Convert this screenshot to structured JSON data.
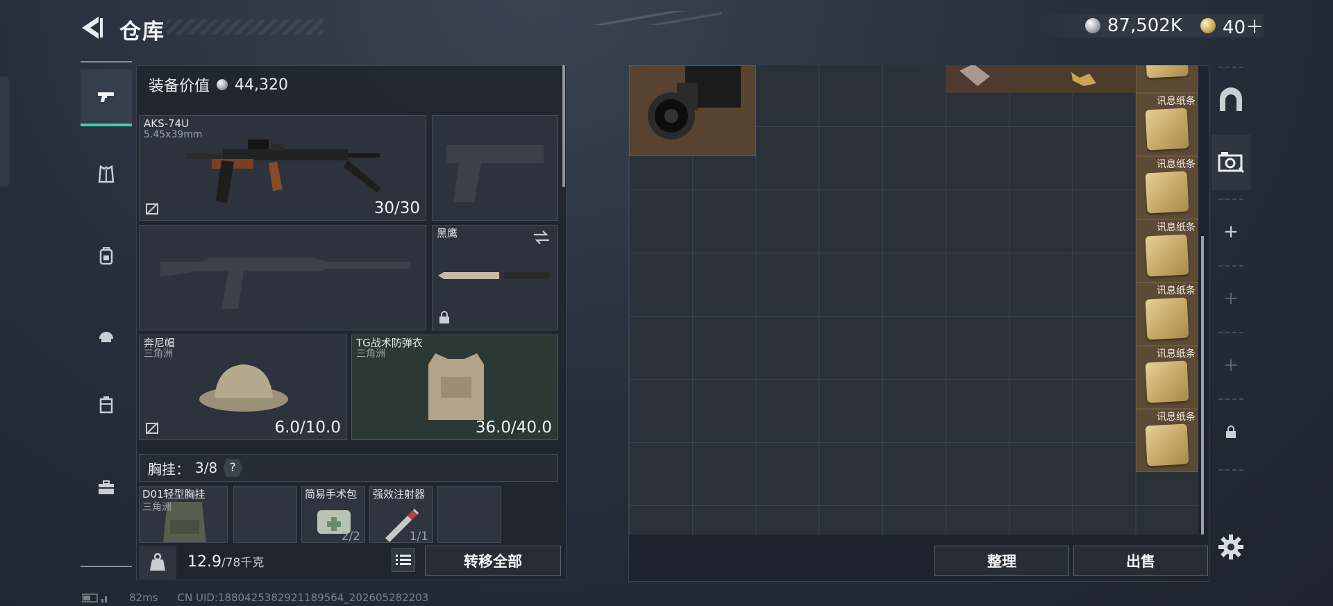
{
  "header": {
    "title": "仓库",
    "silver_amount": "87,502K",
    "gold_amount": "40＋"
  },
  "equipment": {
    "value_label": "装备价值",
    "value_amount": "44,320",
    "primary_weapon": {
      "name": "AKS-74U",
      "caliber": "5.45x39mm",
      "ammo": "30/30"
    },
    "melee": {
      "name": "黑鹰"
    },
    "helmet": {
      "name": "奔尼帽",
      "origin": "三角洲",
      "durability": "6.0/10.0"
    },
    "armor": {
      "name": "TG战术防弹衣",
      "origin": "三角洲",
      "durability": "36.0/40.0"
    },
    "chest_rig": {
      "label": "胸挂：",
      "capacity": "3/8",
      "help": "?"
    },
    "rig_items": [
      {
        "name": "D01轻型胸挂",
        "origin": "三角洲"
      },
      {
        "name": "简易手术包",
        "count": "2/2"
      },
      {
        "name": "强效注射器",
        "count": "1/1"
      }
    ]
  },
  "weight": {
    "current": "12.9",
    "max": "/78千克"
  },
  "buttons": {
    "transfer_all": "转移全部",
    "sort": "整理",
    "sell": "出售"
  },
  "stash": {
    "note_label": "讯息纸条",
    "notes_count": 6
  },
  "footer": {
    "ping": "82ms",
    "uid": "CN UID:18804253829211895​64_202605282203"
  },
  "icons": {
    "rail": [
      "pistol-icon",
      "vest-icon",
      "backpack-icon",
      "helmet-icon",
      "case-icon",
      "briefcase-icon"
    ],
    "tools": [
      "arch-icon",
      "camera-sell-icon",
      "plus-icon",
      "plus-icon",
      "plus-icon",
      "lock-icon"
    ]
  },
  "colors": {
    "accent": "#3fd1b0",
    "note_bg": "#5d4a34",
    "armor_slot": "#2b3834"
  }
}
